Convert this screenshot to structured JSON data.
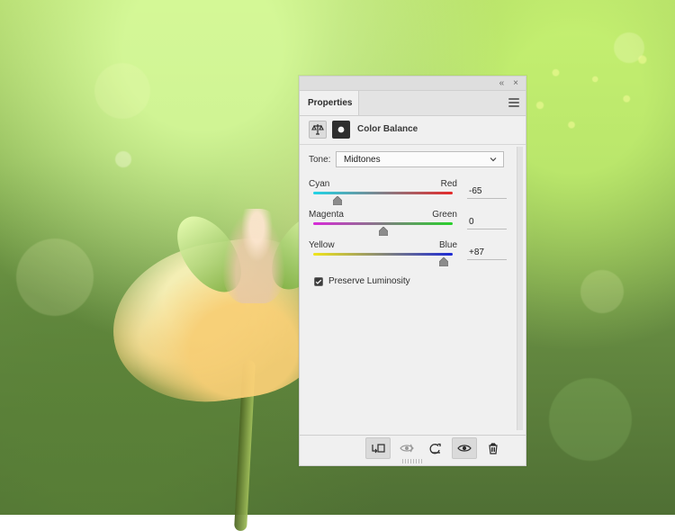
{
  "panel": {
    "tab": "Properties",
    "adjustment": {
      "title": "Color Balance",
      "tone": {
        "label": "Tone:",
        "value": "Midtones"
      },
      "sliders": [
        {
          "left_label": "Cyan",
          "right_label": "Red",
          "value": "-65"
        },
        {
          "left_label": "Magenta",
          "right_label": "Green",
          "value": "0"
        },
        {
          "left_label": "Yellow",
          "right_label": "Blue",
          "value": "+87"
        }
      ],
      "preserve_luminosity": {
        "label": "Preserve Luminosity",
        "checked": true
      }
    }
  },
  "icons": {
    "panel_collapse": "double-chevron-icon",
    "panel_close": "close-icon",
    "panel_menu": "hamburger-menu-icon",
    "color_balance": "balance-scale-icon",
    "mask": "mask-icon",
    "clip_to_layer": "clip-to-layer-icon",
    "view_previous": "view-previous-state-icon",
    "reset": "reset-icon",
    "visibility": "eye-icon",
    "delete": "trash-icon"
  },
  "colors": {
    "panel_bg": "#f0f0f0",
    "panel_border": "#cfcfcf",
    "text": "#2b2b2b"
  }
}
